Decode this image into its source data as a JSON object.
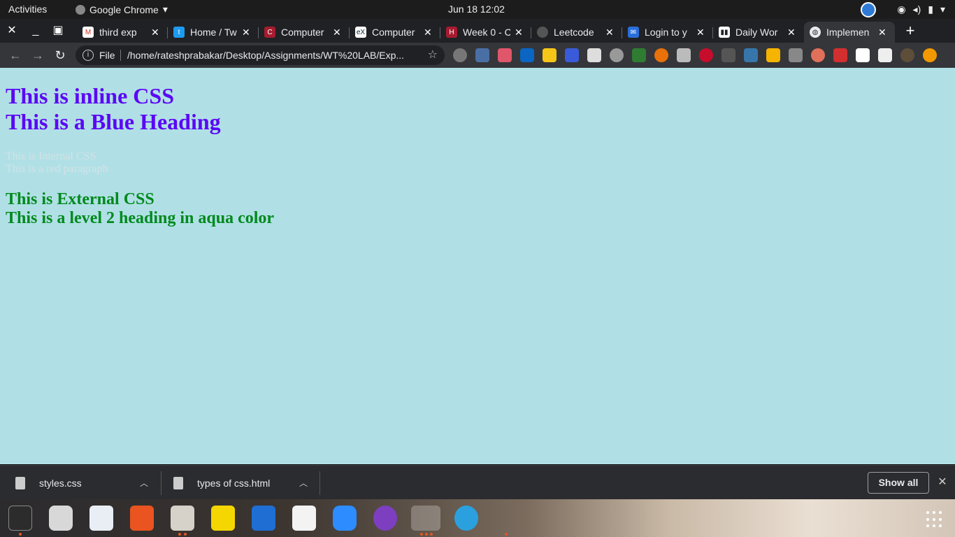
{
  "topbar": {
    "activities": "Activities",
    "app_name": "Google Chrome",
    "clock": "Jun 18  12:02"
  },
  "tabs": [
    {
      "title": "third exp",
      "icon": "gmail-icon",
      "color": "#d93025"
    },
    {
      "title": "Home / Tw",
      "icon": "twitter-icon",
      "color": "#1d9bf0"
    },
    {
      "title": "Computer",
      "icon": "edu-icon",
      "color": "#a51c30"
    },
    {
      "title": "Computer",
      "icon": "edx-icon",
      "color": "#02262b"
    },
    {
      "title": "Week 0 - C",
      "icon": "harvard-icon",
      "color": "#a51c30"
    },
    {
      "title": "Leetcode",
      "icon": "github-icon",
      "color": "#555555"
    },
    {
      "title": "Login to y",
      "icon": "mail-icon",
      "color": "#2a6fdb"
    },
    {
      "title": "Daily Wor",
      "icon": "trello-icon",
      "color": "#ffffff"
    },
    {
      "title": "Implemen",
      "icon": "globe-icon",
      "color": "#9aa0a6",
      "active": true
    }
  ],
  "omnibox": {
    "scheme_label": "File",
    "url": "/home/rateshprabakar/Desktop/Assignments/WT%20LAB/Exp..."
  },
  "page": {
    "heading_inline": "This is inline CSS",
    "heading_blue": "This is a Blue Heading",
    "para_internal": "This is Internal CSS",
    "para_red": "This is a red paragraph",
    "heading_external": "This is External CSS",
    "heading_aqua": "This is a level 2 heading in aqua color",
    "background_color": "#b0e0e6"
  },
  "downloads": {
    "items": [
      {
        "name": "styles.css"
      },
      {
        "name": "types of css.html"
      }
    ],
    "show_all": "Show all"
  },
  "extensions": [
    "chat-bubble",
    "mail-badge",
    "flag-badge",
    "linkedin-badge",
    "m-yellow",
    "wave",
    "reader",
    "bulb",
    "screenshot",
    "h-orange",
    "paste",
    "abp",
    "recycle",
    "python",
    "thumb",
    "feather",
    "ring",
    "pdf-red",
    "pdf-white",
    "pen",
    "avatar",
    "alert"
  ]
}
